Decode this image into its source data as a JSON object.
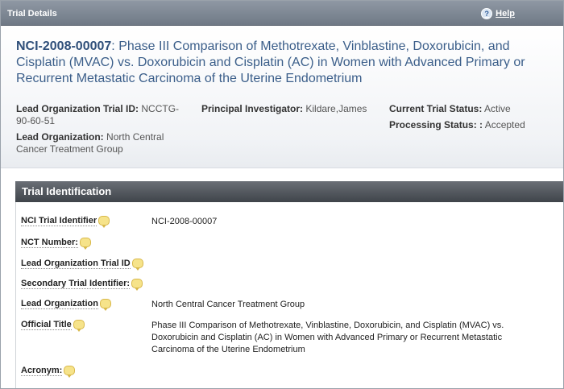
{
  "titlebar": {
    "title": "Trial Details",
    "help_label": "Help"
  },
  "header": {
    "trial_id": "NCI-2008-00007",
    "trial_title": ": Phase III Comparison of Methotrexate, Vinblastine, Doxorubicin, and Cisplatin (MVAC) vs. Doxorubicin and Cisplatin (AC) in Women with Advanced Primary or Recurrent Metastatic Carcinoma of the Uterine Endometrium",
    "lead_org_trial_id_label": "Lead Organization Trial ID:",
    "lead_org_trial_id_value": "NCCTG-90-60-51",
    "lead_org_label": "Lead Organization:",
    "lead_org_value": "North Central Cancer Treatment Group",
    "pi_label": "Principal Investigator:",
    "pi_value": "Kildare,James",
    "status_label": "Current Trial Status:",
    "status_value": "Active",
    "processing_label": "Processing Status: :",
    "processing_value": "Accepted"
  },
  "section": {
    "title": "Trial Identification",
    "fields": [
      {
        "label": "NCI Trial Identifier",
        "value": "NCI-2008-00007"
      },
      {
        "label": "NCT Number:",
        "value": ""
      },
      {
        "label": "Lead Organization Trial ID",
        "value": ""
      },
      {
        "label": "Secondary Trial Identifier:",
        "value": ""
      },
      {
        "label": "Lead Organization",
        "value": "North Central Cancer Treatment Group"
      },
      {
        "label": "Official Title",
        "value": "Phase III Comparison of Methotrexate, Vinblastine, Doxorubicin, and Cisplatin (MVAC) vs. Doxorubicin and Cisplatin (AC) in Women with Advanced Primary or Recurrent Metastatic Carcinoma of the Uterine Endometrium"
      },
      {
        "label": "Acronym:",
        "value": ""
      }
    ]
  },
  "colors": {
    "title_blue": "#3b5e8a",
    "section_bar": "#4a4f55",
    "info_icon": "#f6e38a"
  }
}
